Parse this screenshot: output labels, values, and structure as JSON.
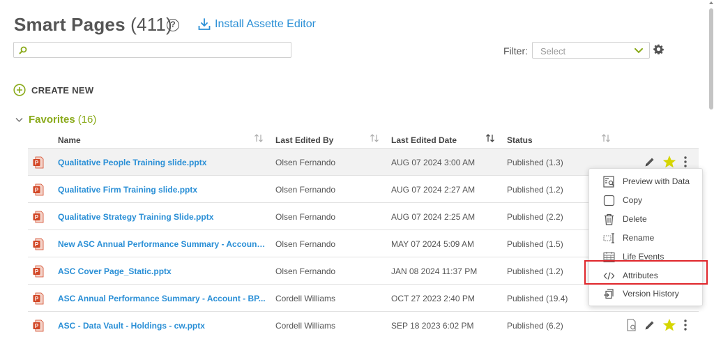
{
  "header": {
    "title": "Smart Pages",
    "count": "(411)",
    "help_symbol": "?",
    "install_label": "Install Assette Editor"
  },
  "search": {
    "value": "",
    "placeholder": ""
  },
  "filter": {
    "label": "Filter:",
    "placeholder": "Select"
  },
  "create_new": {
    "label": "CREATE NEW"
  },
  "favorites": {
    "title": "Favorites",
    "count": "(16)"
  },
  "columns": {
    "name": "Name",
    "last_edited_by": "Last Edited By",
    "last_edited_date": "Last Edited Date",
    "status": "Status"
  },
  "rows": [
    {
      "name": "Qualitative People Training slide.pptx",
      "editor": "Olsen Fernando",
      "date": "AUG 07 2024 3:00 AM",
      "status": "Published (1.3)"
    },
    {
      "name": "Qualitative Firm Training slide.pptx",
      "editor": "Olsen Fernando",
      "date": "AUG 07 2024 2:27 AM",
      "status": "Published (1.2)"
    },
    {
      "name": "Qualitative Strategy Training Slide.pptx",
      "editor": "Olsen Fernando",
      "date": "AUG 07 2024 2:25 AM",
      "status": "Published (2.2)"
    },
    {
      "name": "New ASC Annual Performance Summary - Account ...",
      "editor": "Olsen Fernando",
      "date": "MAY 07 2024 5:09 AM",
      "status": "Published (1.5)"
    },
    {
      "name": "ASC Cover Page_Static.pptx",
      "editor": "Olsen Fernando",
      "date": "JAN 08 2024 11:37 PM",
      "status": "Published (1.2)"
    },
    {
      "name": "ASC Annual Performance Summary - Account - BP...",
      "editor": "Cordell Williams",
      "date": "OCT 27 2023 2:40 PM",
      "status": "Published (19.4)"
    },
    {
      "name": "ASC - Data Vault - Holdings - cw.pptx",
      "editor": "Cordell Williams",
      "date": "SEP 18 2023 6:02 PM",
      "status": "Published (6.2)"
    }
  ],
  "context_menu": {
    "items": [
      {
        "label": "Preview with Data",
        "icon": "preview-data-icon"
      },
      {
        "label": "Copy",
        "icon": "copy-icon"
      },
      {
        "label": "Delete",
        "icon": "trash-icon"
      },
      {
        "label": "Rename",
        "icon": "rename-icon"
      },
      {
        "label": "Life Events",
        "icon": "calendar-icon"
      },
      {
        "label": "Attributes",
        "icon": "code-icon"
      },
      {
        "label": "Version History",
        "icon": "history-icon"
      }
    ]
  },
  "colors": {
    "accent_green": "#8aaa1a",
    "link_blue": "#2a8fd6",
    "star_yellow": "#d6d600",
    "highlight_red": "#e0262b",
    "ppt_red": "#d24726"
  }
}
